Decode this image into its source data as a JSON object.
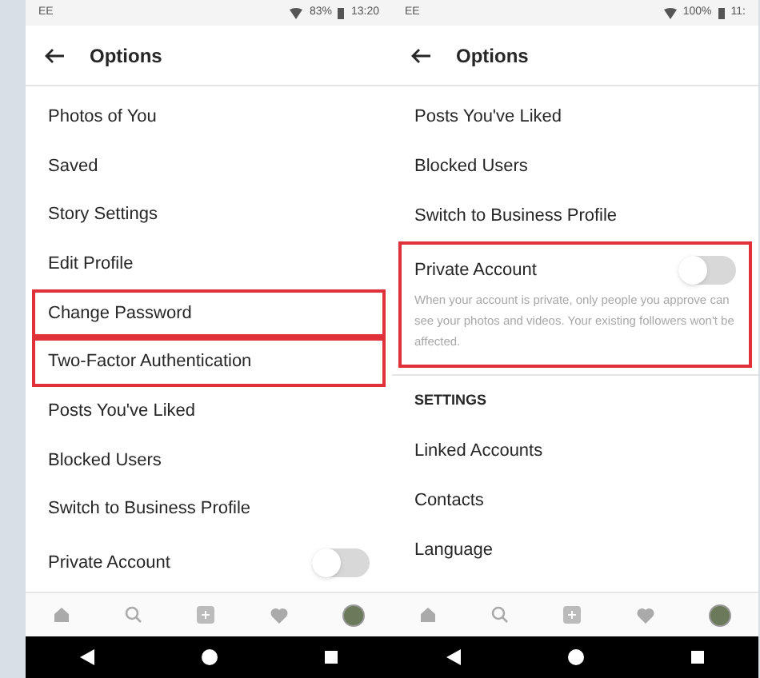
{
  "phones": [
    {
      "status_bar": {
        "left": "EE",
        "battery": "83%",
        "time": "13:20"
      },
      "header": {
        "title": "Options"
      },
      "items": [
        {
          "kind": "item",
          "label": "Photos of You",
          "highlighted": false
        },
        {
          "kind": "item",
          "label": "Saved",
          "highlighted": false
        },
        {
          "kind": "item",
          "label": "Story Settings",
          "highlighted": false
        },
        {
          "kind": "item",
          "label": "Edit Profile",
          "highlighted": false
        },
        {
          "kind": "item",
          "label": "Change Password",
          "highlighted": true
        },
        {
          "kind": "item",
          "label": "Two-Factor Authentication",
          "highlighted": true
        },
        {
          "kind": "item",
          "label": "Posts You've Liked",
          "highlighted": false
        },
        {
          "kind": "item",
          "label": "Blocked Users",
          "highlighted": false
        },
        {
          "kind": "item",
          "label": "Switch to Business Profile",
          "highlighted": false
        },
        {
          "kind": "toggle",
          "label": "Private Account",
          "on": false,
          "highlighted": false
        }
      ]
    },
    {
      "status_bar": {
        "left": "EE",
        "battery": "100%",
        "time": "11:"
      },
      "header": {
        "title": "Options"
      },
      "items": [
        {
          "kind": "item",
          "label": "Posts You've Liked",
          "highlighted": false
        },
        {
          "kind": "item",
          "label": "Blocked Users",
          "highlighted": false
        },
        {
          "kind": "item",
          "label": "Switch to Business Profile",
          "highlighted": false
        },
        {
          "kind": "toggle",
          "label": "Private Account",
          "on": false,
          "highlighted": true,
          "description": "When your account is private, only people you approve can see your photos and videos. Your existing followers won't be affected."
        },
        {
          "kind": "section",
          "label": "SETTINGS",
          "highlighted": false
        },
        {
          "kind": "item",
          "label": "Linked Accounts",
          "highlighted": false
        },
        {
          "kind": "item",
          "label": "Contacts",
          "highlighted": false
        },
        {
          "kind": "item",
          "label": "Language",
          "highlighted": false
        }
      ]
    }
  ]
}
